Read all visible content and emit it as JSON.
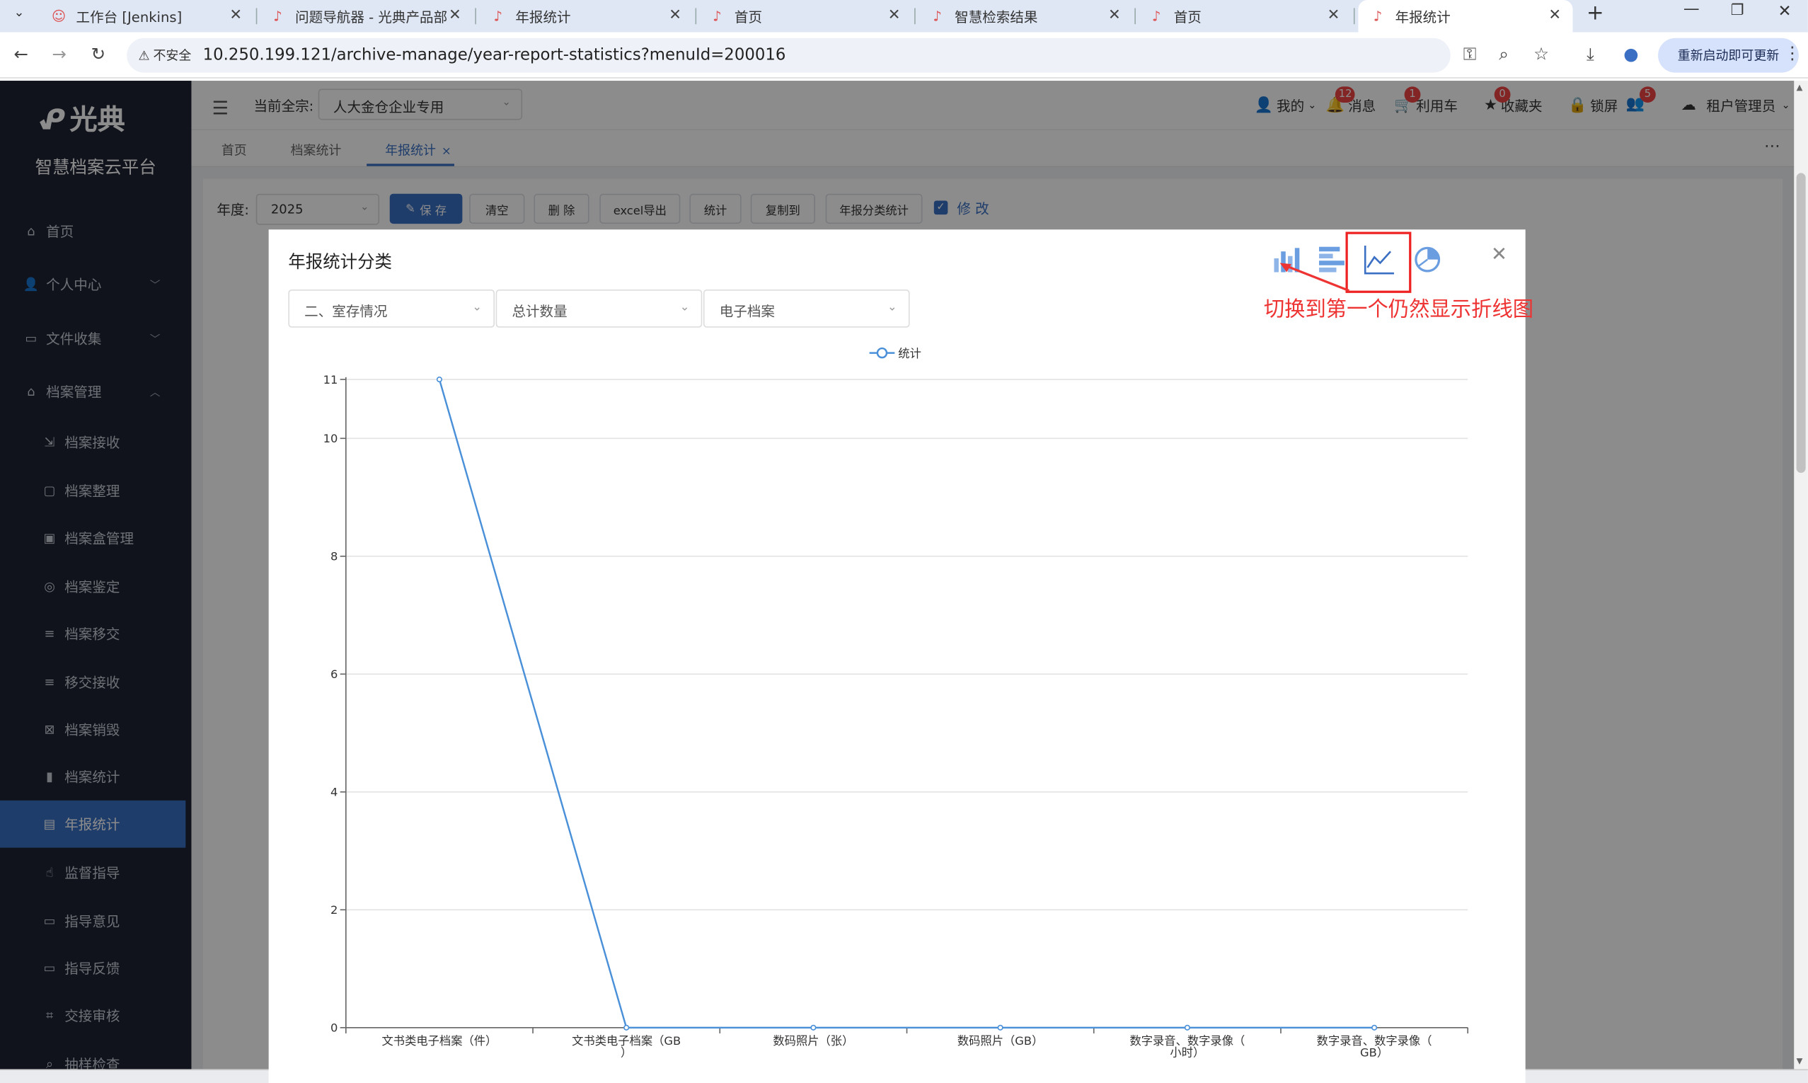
{
  "browser": {
    "tabs": [
      {
        "title": "工作台 [Jenkins]"
      },
      {
        "title": "问题导航器 - 光典产品部"
      },
      {
        "title": "年报统计"
      },
      {
        "title": "首页"
      },
      {
        "title": "智慧检索结果"
      },
      {
        "title": "首页"
      },
      {
        "title": "年报统计"
      }
    ],
    "security_label": "不安全",
    "url": "10.250.199.121/archive-manage/year-report-statistics?menuId=200016",
    "update_button": "重新启动即可更新"
  },
  "sidebar": {
    "logo_text": "光典",
    "platform_title": "智慧档案云平台",
    "items": [
      {
        "label": "首页",
        "icon": "home-icon"
      },
      {
        "label": "个人中心",
        "icon": "user-icon"
      },
      {
        "label": "文件收集",
        "icon": "briefcase-icon"
      },
      {
        "label": "档案管理",
        "icon": "bank-icon"
      },
      {
        "label": "档案接收",
        "icon": "receive-icon"
      },
      {
        "label": "档案整理",
        "icon": "folder-icon"
      },
      {
        "label": "档案盒管理",
        "icon": "box-icon"
      },
      {
        "label": "档案鉴定",
        "icon": "target-icon"
      },
      {
        "label": "档案移交",
        "icon": "list-icon"
      },
      {
        "label": "移交接收",
        "icon": "list-icon"
      },
      {
        "label": "档案销毁",
        "icon": "destroy-icon"
      },
      {
        "label": "档案统计",
        "icon": "bar-chart-icon"
      },
      {
        "label": "年报统计",
        "icon": "report-icon"
      },
      {
        "label": "监督指导",
        "icon": "hand-icon"
      },
      {
        "label": "指导意见",
        "icon": "comment-icon"
      },
      {
        "label": "指导反馈",
        "icon": "feedback-icon"
      },
      {
        "label": "交接审核",
        "icon": "crop-icon"
      },
      {
        "label": "抽样检查",
        "icon": "search-icon"
      }
    ]
  },
  "header": {
    "quanzong_label": "当前全宗:",
    "quanzong_value": "人大金仓企业专用",
    "my_label": "我的",
    "messages_label": "消息",
    "messages_badge": "12",
    "cart_label": "利用车",
    "cart_badge": "1",
    "favorites_label": "收藏夹",
    "favorites_badge": "0",
    "lock_label": "锁屏",
    "user_badge": "5",
    "tenant_label": "租户管理员"
  },
  "tags": [
    "首页",
    "档案统计",
    "年报统计"
  ],
  "toolbar": {
    "year_label": "年度:",
    "year_value": "2025",
    "save": "保 存",
    "clear": "清空",
    "delete": "删 除",
    "excel": "excel导出",
    "stat": "统计",
    "copy": "复制到",
    "classify": "年报分类统计",
    "modify": "修 改"
  },
  "dialog": {
    "title": "年报统计分类",
    "select1": "二、室存情况",
    "select2": "总计数量",
    "select3": "电子档案",
    "annotation": "切换到第一个仍然显示折线图",
    "chart_type_icons": [
      "bar-chart-icon",
      "horizontal-bar-icon",
      "line-chart-icon",
      "pie-chart-icon"
    ]
  },
  "chart_data": {
    "type": "line",
    "categories": [
      "文书类电子档案（件）",
      "文书类电子档案（GB）",
      "数码照片（张）",
      "数码照片（GB）",
      "数字录音、数字录像（小时）",
      "数字录音、数字录像（GB）"
    ],
    "category_lines": [
      [
        "文书类电子档案（件）"
      ],
      [
        "文书类电子档案（GB",
        "）"
      ],
      [
        "数码照片（张）"
      ],
      [
        "数码照片（GB）"
      ],
      [
        "数字录音、数字录像（",
        "小时）"
      ],
      [
        "数字录音、数字录像（",
        "GB）"
      ]
    ],
    "series": [
      {
        "name": "统计",
        "values": [
          11,
          0,
          0,
          0,
          0,
          0
        ]
      }
    ],
    "yticks": [
      0,
      2,
      4,
      6,
      8,
      10,
      11
    ],
    "ylim": [
      0,
      11
    ],
    "grid": true,
    "color": "#4a90d9"
  }
}
